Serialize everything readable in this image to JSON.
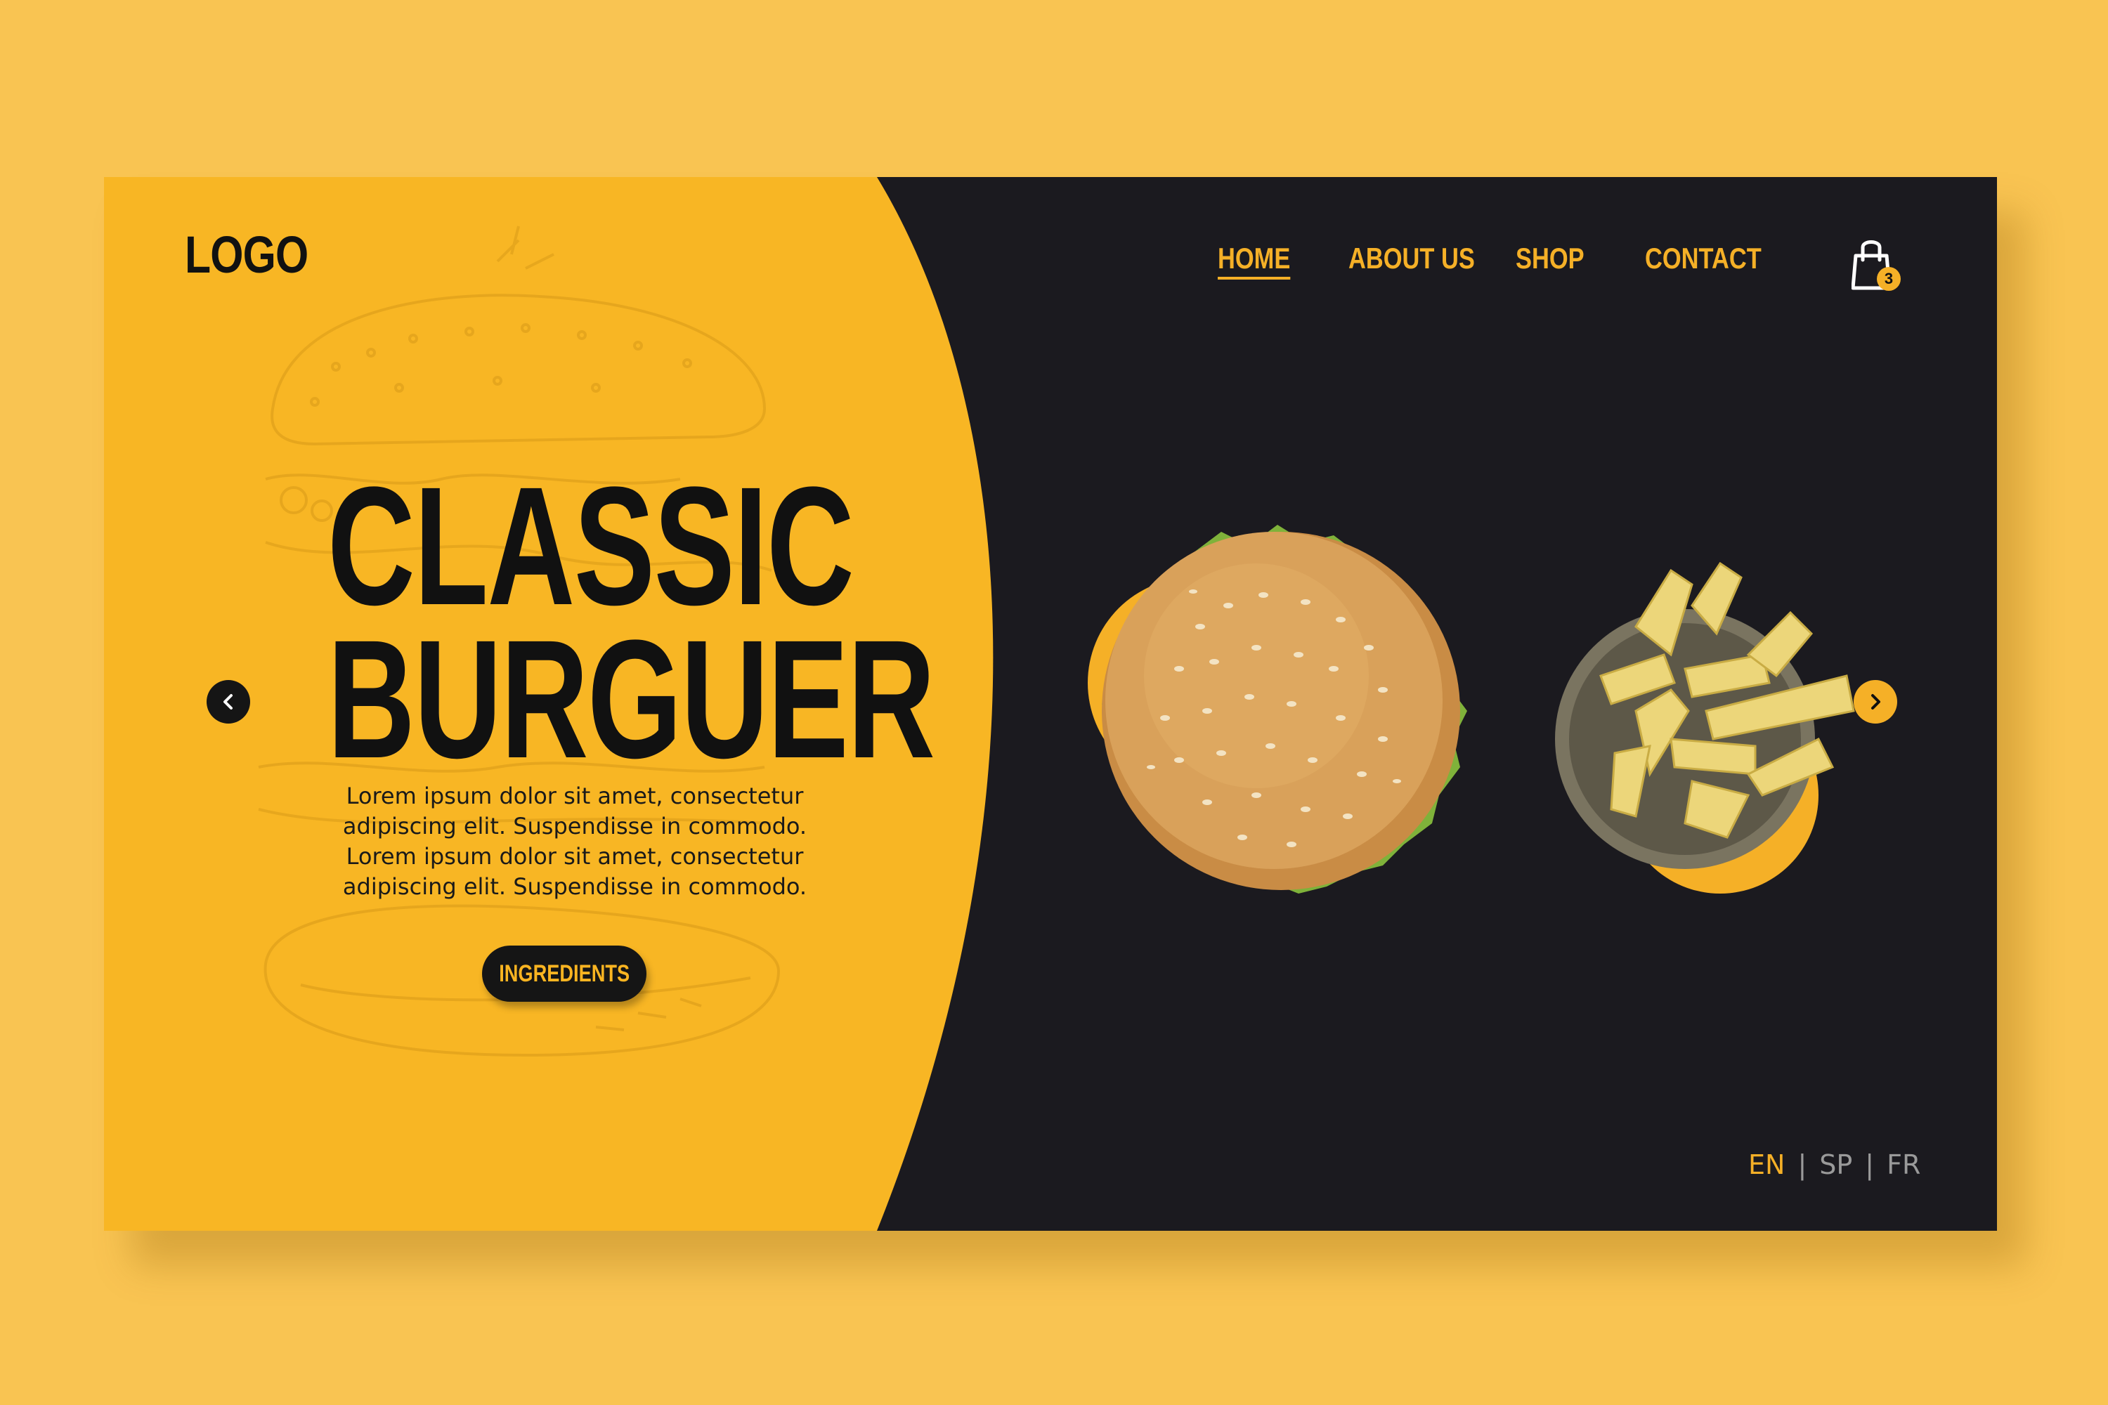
{
  "brand": {
    "logo": "LOGO"
  },
  "nav": {
    "items": [
      {
        "label": "HOME",
        "active": true
      },
      {
        "label": "ABOUT US",
        "active": false
      },
      {
        "label": "SHOP",
        "active": false
      },
      {
        "label": "CONTACT",
        "active": false
      }
    ],
    "cart_count": "3"
  },
  "hero": {
    "title_line1": "CLASSIC",
    "title_line2": "BURGUER",
    "description": [
      "Lorem ipsum dolor sit amet, consectetur",
      "adipiscing elit. Suspendisse in commodo.",
      "Lorem ipsum dolor sit amet, consectetur",
      "adipiscing elit. Suspendisse in commodo."
    ],
    "button_label": "INGREDIENTS"
  },
  "languages": {
    "items": [
      "EN",
      "SP",
      "FR"
    ],
    "active": "EN",
    "separator": "|"
  },
  "icons": {
    "cart": "shopping-bag-icon",
    "prev": "chevron-left-icon",
    "next": "chevron-right-icon"
  },
  "colors": {
    "background": "#f9c452",
    "accent": "#f5b027",
    "panel_dark": "#1b1a1f",
    "text_dark": "#111111"
  }
}
